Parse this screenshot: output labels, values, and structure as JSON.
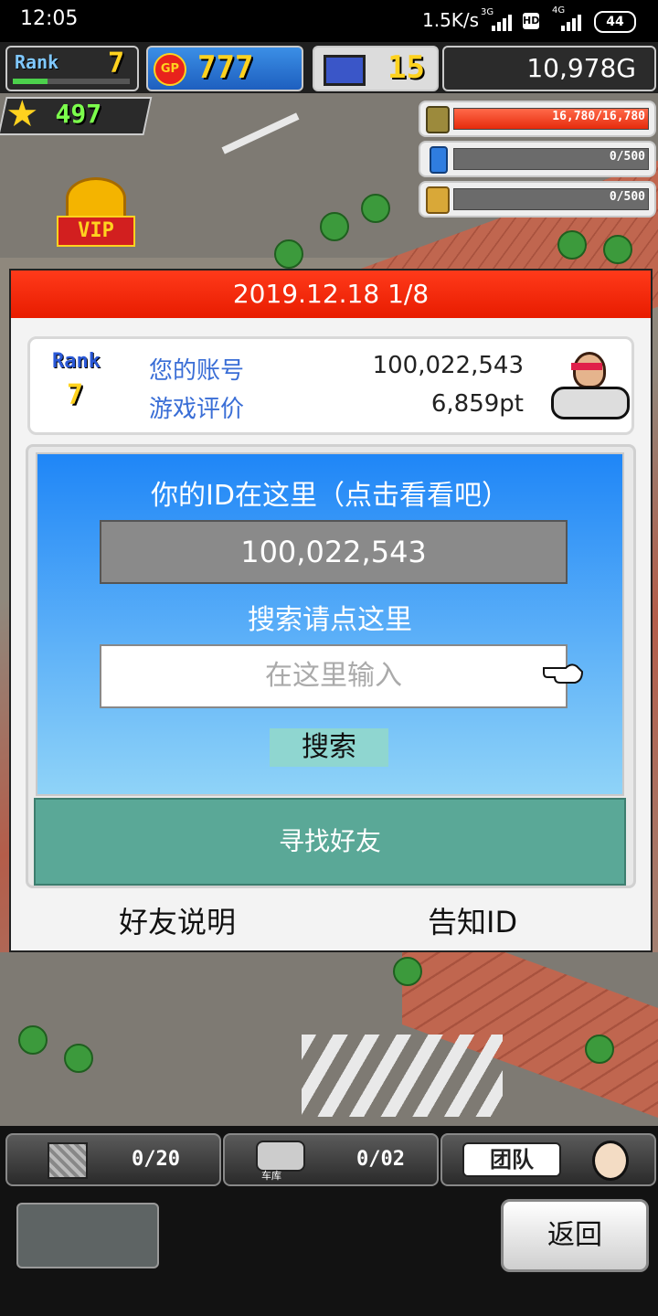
{
  "status_bar": {
    "time": "12:05",
    "speed": "1.5K/s",
    "network": "3G",
    "hd": "HD",
    "network2": "4G",
    "battery": "44"
  },
  "hud": {
    "rank_label": "Rank",
    "rank_value": "7",
    "gp_label": "GP",
    "gp_value": "777",
    "devices_value": "15",
    "money": "10,978G",
    "stars": "497"
  },
  "resources": [
    {
      "icon": "coins-icon",
      "text": "16,780/16,780",
      "fill": 1.0
    },
    {
      "icon": "bottle-icon",
      "text": "0/500",
      "fill": 0.0
    },
    {
      "icon": "wheat-icon",
      "text": "0/500",
      "fill": 0.0
    }
  ],
  "vip_label": "VIP",
  "dialog": {
    "header": "2019.12.18 1/8",
    "rank_label": "Rank",
    "rank_value": "7",
    "account_label": "您的账号",
    "account_value": "100,022,543",
    "rating_label": "游戏评价",
    "rating_value": "6,859pt",
    "id_title": "你的ID在这里（点击看看吧）",
    "id_value": "100,022,543",
    "search_title": "搜索请点这里",
    "search_placeholder": "在这里输入",
    "search_button": "搜索",
    "find_friends_button": "寻找好友",
    "friend_help_link": "好友说明",
    "share_id_link": "告知ID"
  },
  "bottom_bar": {
    "tab1_count": "0/20",
    "tab2_caption": "车库",
    "tab2_count": "0/02",
    "team_label": "团队",
    "back_button": "返回"
  },
  "colors": {
    "header_red": "#ff3a1a",
    "accent_blue": "#1f86f7",
    "find_green": "#5aa897",
    "link_blue": "#3a6ed6"
  }
}
